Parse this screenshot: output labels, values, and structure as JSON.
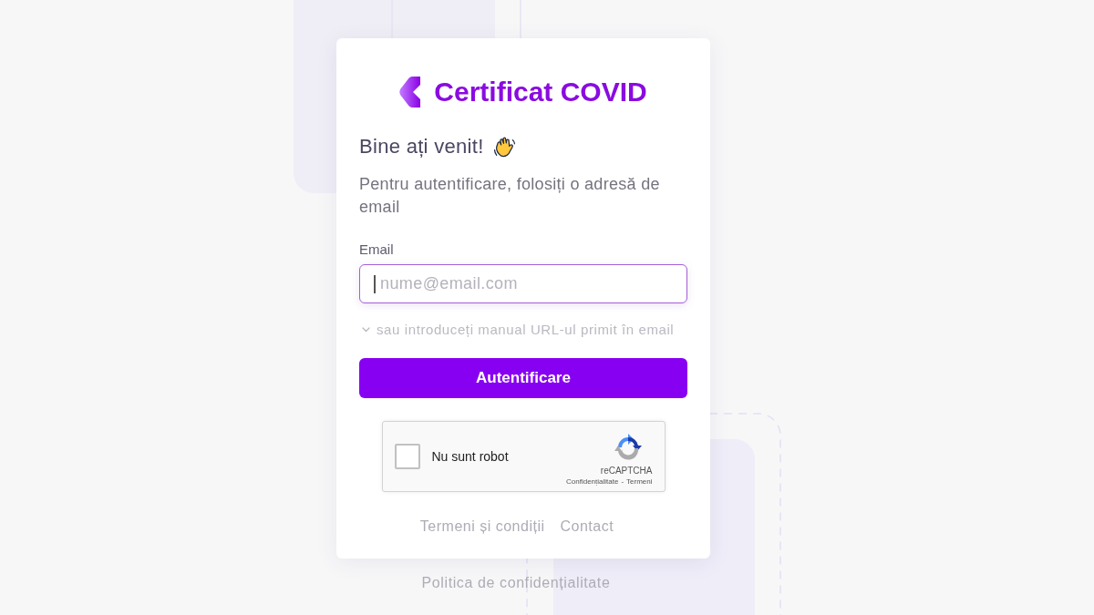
{
  "card": {
    "logo": {
      "title": "Certificat COVID"
    },
    "heading": "Bine ați venit!",
    "intro": "Pentru autentificare, folosiți o adresă de email",
    "email_field": {
      "label": "Email",
      "placeholder": "nume@email.com",
      "focused": true
    },
    "url_toggle": {
      "label": "sau introduceți manual URL-ul primit în email",
      "expanded": false
    },
    "submit_button": "Autentificare",
    "recaptcha": {
      "checkbox": {
        "label": "Nu sunt robot",
        "checked": false
      },
      "brand": "reCAPTCHA",
      "links": [
        "Confidențialitate",
        "Termeni"
      ],
      "separator": "-"
    },
    "footer_links": [
      "Termeni și condiții",
      "Contact"
    ]
  },
  "privacy_link": "Politica de confidențialitate"
}
